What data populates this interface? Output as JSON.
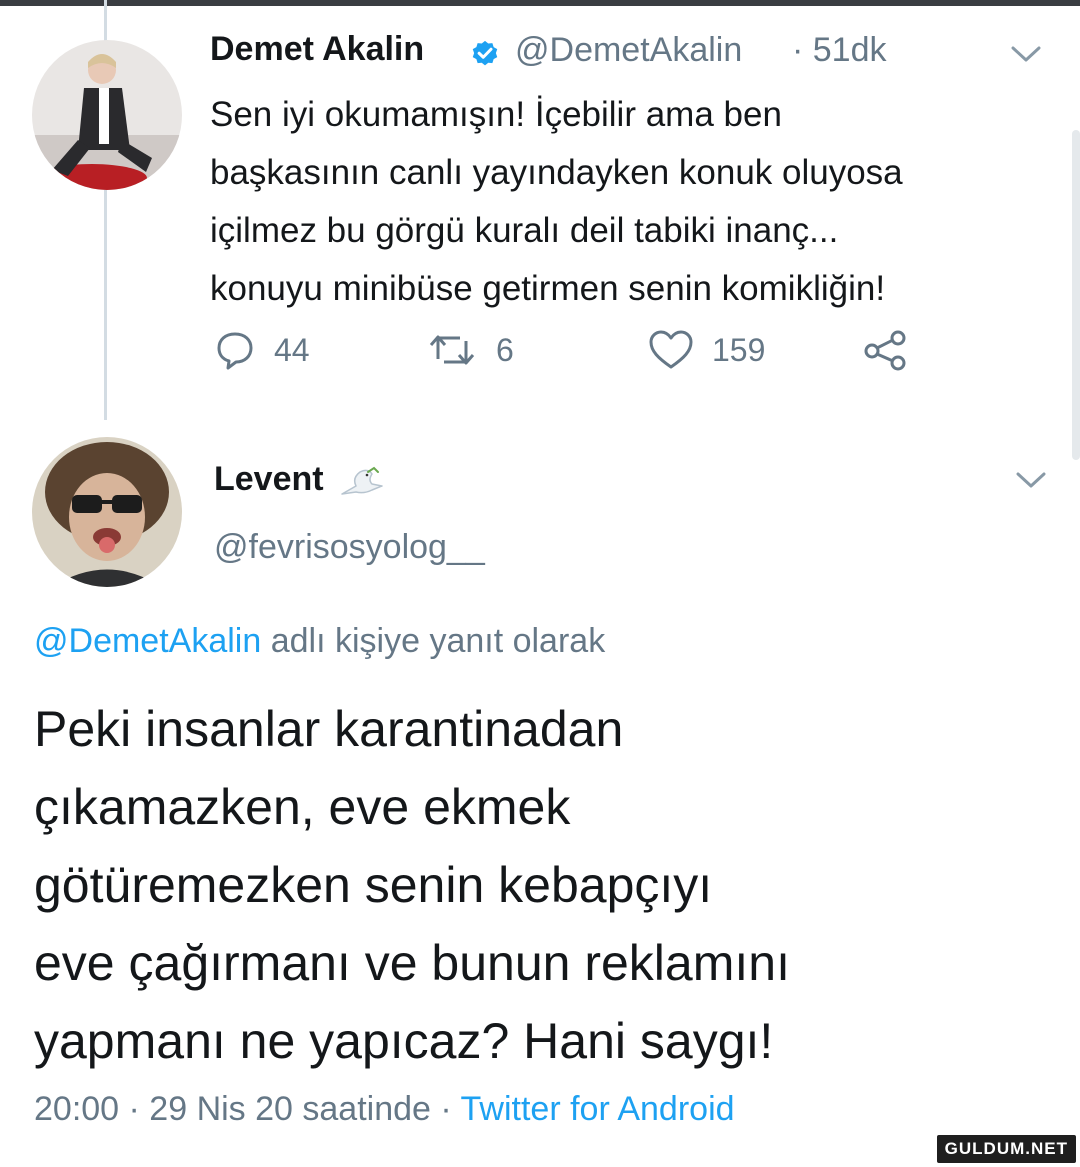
{
  "tweet1": {
    "author_name": "Demet Akalin",
    "handle": "@DemetAkalin",
    "time": "· 51dk",
    "text_lines": [
      "Sen iyi okumamışın! İçebilir ama ben",
      "başkasının canlı yayındayken konuk oluyosa",
      "içilmez bu görgü kuralı deil tabiki inanç...",
      "konuyu minibüse getirmen senin komikliğin!"
    ],
    "reply_count": "44",
    "retweet_count": "6",
    "like_count": "159"
  },
  "tweet2": {
    "author_name": "Levent",
    "handle": "@fevrisosyolog__",
    "reply_to_handle": "@DemetAkalin",
    "reply_to_suffix": " adlı kişiye yanıt olarak",
    "text_lines": [
      "Peki insanlar karantinadan",
      "çıkamazken, eve ekmek",
      "götüremezken senin kebapçıyı",
      "eve çağırmanı ve bunun reklamını",
      "yapmanı ne yapıcaz? Hani saygı!"
    ],
    "timestamp": "20:00 · 29 Nis 20 saatinde · ",
    "source": "Twitter for Android"
  },
  "watermark": "GULDUM.NET",
  "colors": {
    "link": "#1da1f2",
    "secondary_text": "#657786",
    "primary_text": "#14171a",
    "verified": "#1da1f2"
  },
  "icons": [
    "verified-badge-icon",
    "chevron-down-icon",
    "reply-icon",
    "retweet-icon",
    "like-icon",
    "share-icon",
    "dove-emoji-icon"
  ]
}
